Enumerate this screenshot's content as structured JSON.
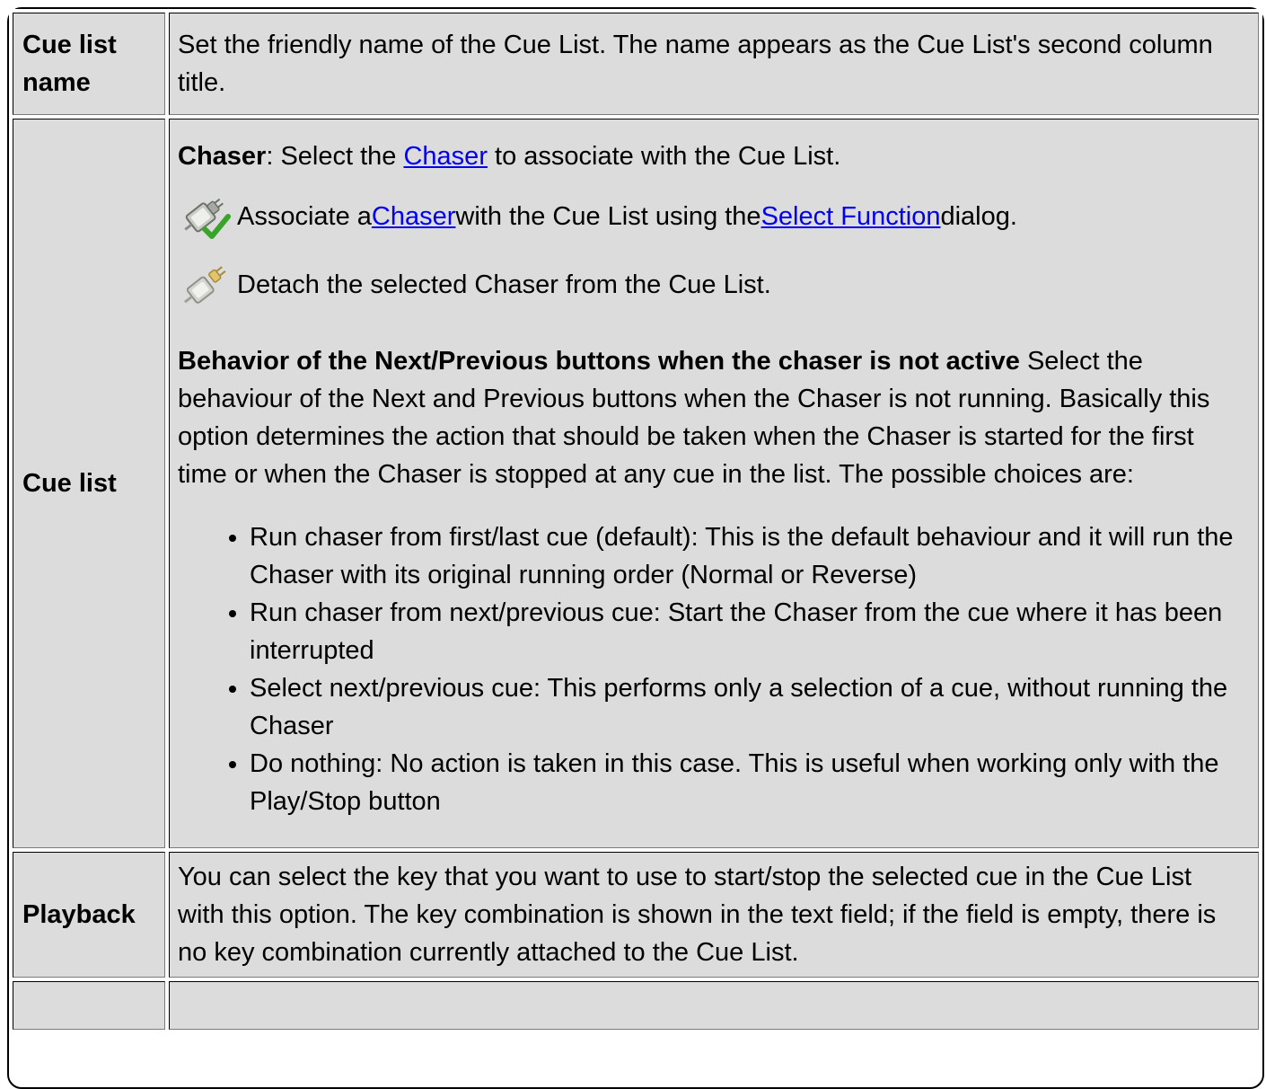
{
  "rows": {
    "cue_list_name": {
      "label": "Cue list name",
      "description": "Set the friendly name of the Cue List. The name appears as the Cue List's second column title."
    },
    "cue_list": {
      "label": "Cue list",
      "chaser_heading": "Chaser",
      "chaser_text_a": ": Select the ",
      "chaser_link": "Chaser",
      "chaser_text_b": " to associate with the Cue List.",
      "attach_text_a": "Associate a ",
      "attach_link_chaser": "Chaser",
      "attach_text_b": " with the Cue List using the ",
      "attach_link_select": "Select Function",
      "attach_text_c": " dialog.",
      "detach_text": "Detach the selected Chaser from the Cue List.",
      "behavior_heading": "Behavior of the Next/Previous buttons when the chaser is not active",
      "behavior_text": " Select the behaviour of the Next and Previous buttons when the Chaser is not running. Basically this option determines the action that should be taken when the Chaser is started for the first time or when the Chaser is stopped at any cue in the list. The possible choices are:",
      "choices": [
        "Run chaser from first/last cue (default): This is the default behaviour and it will run the Chaser with its original running order (Normal or Reverse)",
        "Run chaser from next/previous cue: Start the Chaser from the cue where it has been interrupted",
        "Select next/previous cue: This performs only a selection of a cue, without running the Chaser",
        "Do nothing: No action is taken in this case. This is useful when working only with the Play/Stop button"
      ],
      "icons": [
        "attach-function-icon",
        "detach-function-icon"
      ]
    },
    "playback": {
      "label": "Playback",
      "description": "You can select the key that you want to use to start/stop the selected cue in the Cue List with this option. The key combination is shown in the text field; if the field is empty, there is no key combination currently attached to the Cue List."
    }
  },
  "colors": {
    "cell_background": "#dcdcdc",
    "link": "#0000ee",
    "check": "#3aa32a"
  }
}
